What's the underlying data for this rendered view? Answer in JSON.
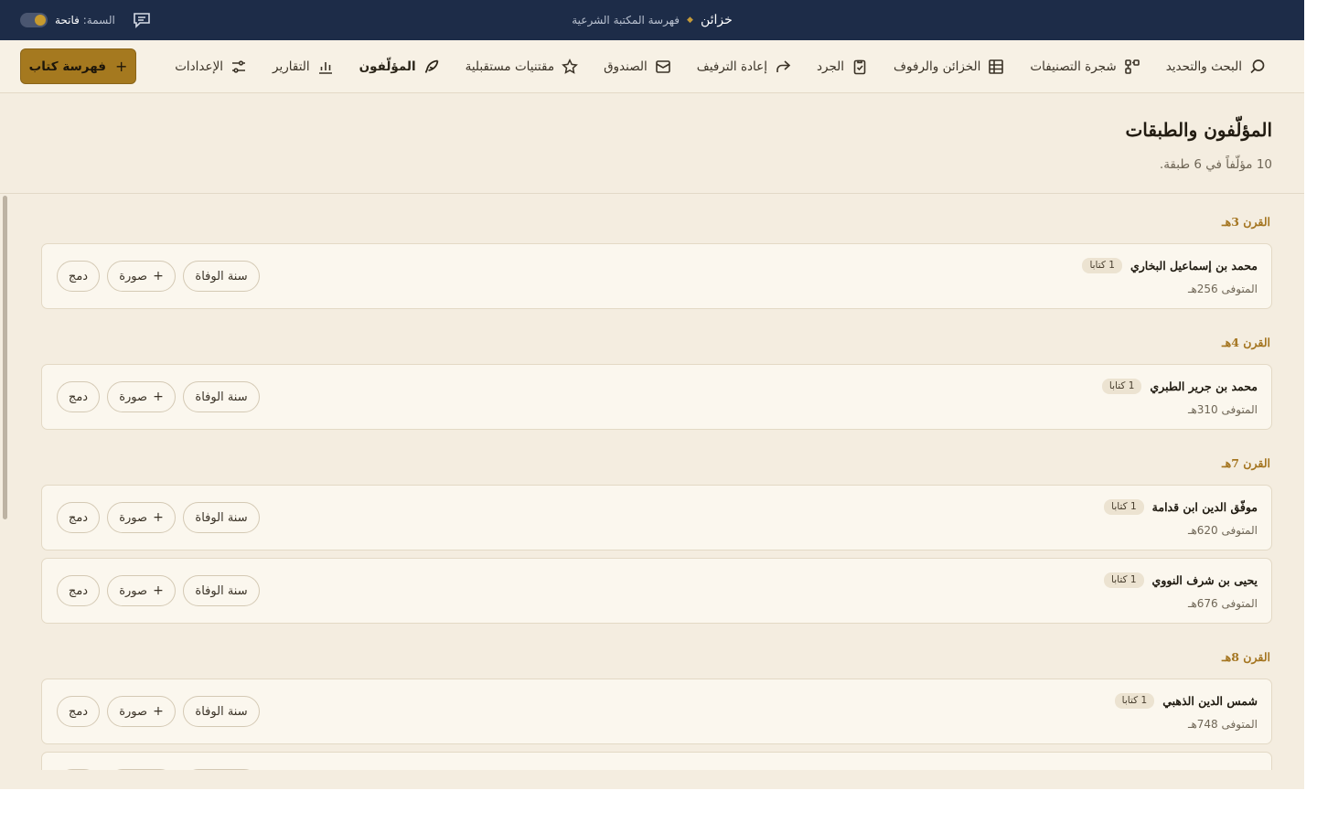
{
  "topbar": {
    "brand_name": "خزائن",
    "brand_sub": "فهرسة المكتبة الشرعية",
    "theme_label": "السمة:",
    "theme_value": "فاتحة"
  },
  "nav": {
    "items": [
      {
        "label": "البحث والتحديد",
        "icon": "search-icon"
      },
      {
        "label": "شجرة التصنيفات",
        "icon": "tree-icon"
      },
      {
        "label": "الخزائن والرفوف",
        "icon": "grid-icon"
      },
      {
        "label": "الجرد",
        "icon": "clipboard-icon"
      },
      {
        "label": "إعادة الترفيف",
        "icon": "share-arrow-icon"
      },
      {
        "label": "الصندوق",
        "icon": "inbox-icon"
      },
      {
        "label": "مقتنيات مستقبلية",
        "icon": "star-icon"
      },
      {
        "label": "المؤلّفون",
        "icon": "quill-icon"
      },
      {
        "label": "التقارير",
        "icon": "bar-chart-icon"
      },
      {
        "label": "الإعدادات",
        "icon": "sliders-icon"
      }
    ],
    "primary_label": "فهرسة كتاب",
    "primary_plus": "+"
  },
  "header": {
    "title": "المؤلّفون والطبقات",
    "subtitle": "10 مؤلّفاً في 6 طبقة."
  },
  "actions": {
    "death_year": "سنة الوفاة",
    "image": "صورة",
    "image_plus": "+",
    "merge": "دمج"
  },
  "groups": [
    {
      "title": "القرن 3هـ",
      "authors": [
        {
          "name": "محمد بن إسماعيل البخاري",
          "badge": "1 كتابا",
          "death": "المتوفى 256هـ"
        }
      ]
    },
    {
      "title": "القرن 4هـ",
      "authors": [
        {
          "name": "محمد بن جرير الطبري",
          "badge": "1 كتابا",
          "death": "المتوفى 310هـ"
        }
      ]
    },
    {
      "title": "القرن 7هـ",
      "authors": [
        {
          "name": "موفّق الدين ابن قدامة",
          "badge": "1 كتابا",
          "death": "المتوفى 620هـ"
        },
        {
          "name": "يحيى بن شرف النووي",
          "badge": "1 كتابا",
          "death": "المتوفى 676هـ"
        }
      ]
    },
    {
      "title": "القرن 8هـ",
      "authors": [
        {
          "name": "شمس الدين الذهبي",
          "badge": "1 كتابا",
          "death": "المتوفى 748هـ"
        }
      ]
    }
  ],
  "colors": {
    "topbar_bg": "#1d2c48",
    "page_bg": "#f4ede0",
    "accent": "#a5791f",
    "group_title": "#a47520"
  }
}
